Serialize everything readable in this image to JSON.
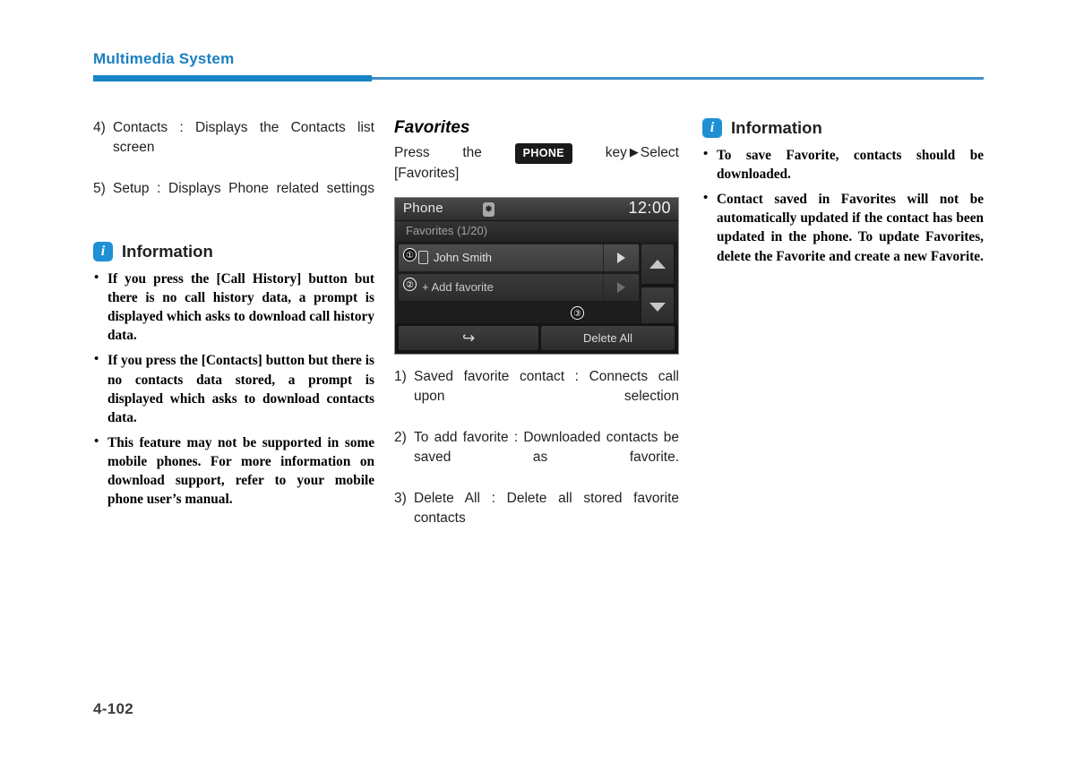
{
  "header": {
    "running_title": "Multimedia System",
    "accent_color": "#1784c7"
  },
  "footer": {
    "page_number": "4-102"
  },
  "column_left": {
    "numbered_items": [
      {
        "marker": "4)",
        "text": "Contacts : Displays the Contacts list screen"
      },
      {
        "marker": "5)",
        "text": "Setup : Displays Phone related settings"
      }
    ],
    "information": {
      "icon": "info-icon",
      "title": "Information",
      "bullets": [
        "If you press the [Call History] button but there is no call history data, a prompt is displayed which asks to download call history data.",
        "If you press the [Contacts] button but there is no contacts data stored, a prompt is displayed which asks to download contacts data.",
        "This feature may not be supported in some mobile phones. For more information on download support, refer to your mobile phone user’s manual."
      ]
    }
  },
  "column_middle": {
    "subheading": "Favorites",
    "instruction": {
      "prefix_word1": "Press",
      "prefix_word2": "the",
      "keycap": "PHONE",
      "suffix_word": "key",
      "arrow": "▶",
      "action": "Select",
      "target": "[Favorites]"
    },
    "screenshot": {
      "title": "Phone",
      "bluetooth_icon": "bluetooth-icon",
      "time": "12:00",
      "subtitle": "Favorites (1/20)",
      "rows": [
        {
          "callout": "①",
          "icon": "mobile-phone-icon",
          "label": "John Smith",
          "chevron": "▶",
          "enabled": true
        },
        {
          "callout": "②",
          "icon": "",
          "label": "+ Add favorite",
          "chevron": "▶",
          "enabled": false
        }
      ],
      "scroll": {
        "up": "▲",
        "down": "▼"
      },
      "bottom_buttons": [
        {
          "name": "back",
          "label": "↩"
        },
        {
          "name": "delete-all",
          "label": "Delete All",
          "callout": "③"
        }
      ]
    },
    "numbered_items": [
      {
        "marker": "1)",
        "text": "Saved favorite contact : Connects call upon selection"
      },
      {
        "marker": "2)",
        "text": "To add favorite : Downloaded contacts be saved as favorite."
      },
      {
        "marker": "3)",
        "text": "Delete All : Delete all stored favorite contacts"
      }
    ]
  },
  "column_right": {
    "information": {
      "icon": "info-icon",
      "title": "Information",
      "bullets": [
        "To save Favorite, contacts should be downloaded.",
        "Contact saved in Favorites will not be automatically updated if the contact has been updated in the phone. To update Favorites, delete the Favorite and create a new Favorite."
      ]
    }
  }
}
